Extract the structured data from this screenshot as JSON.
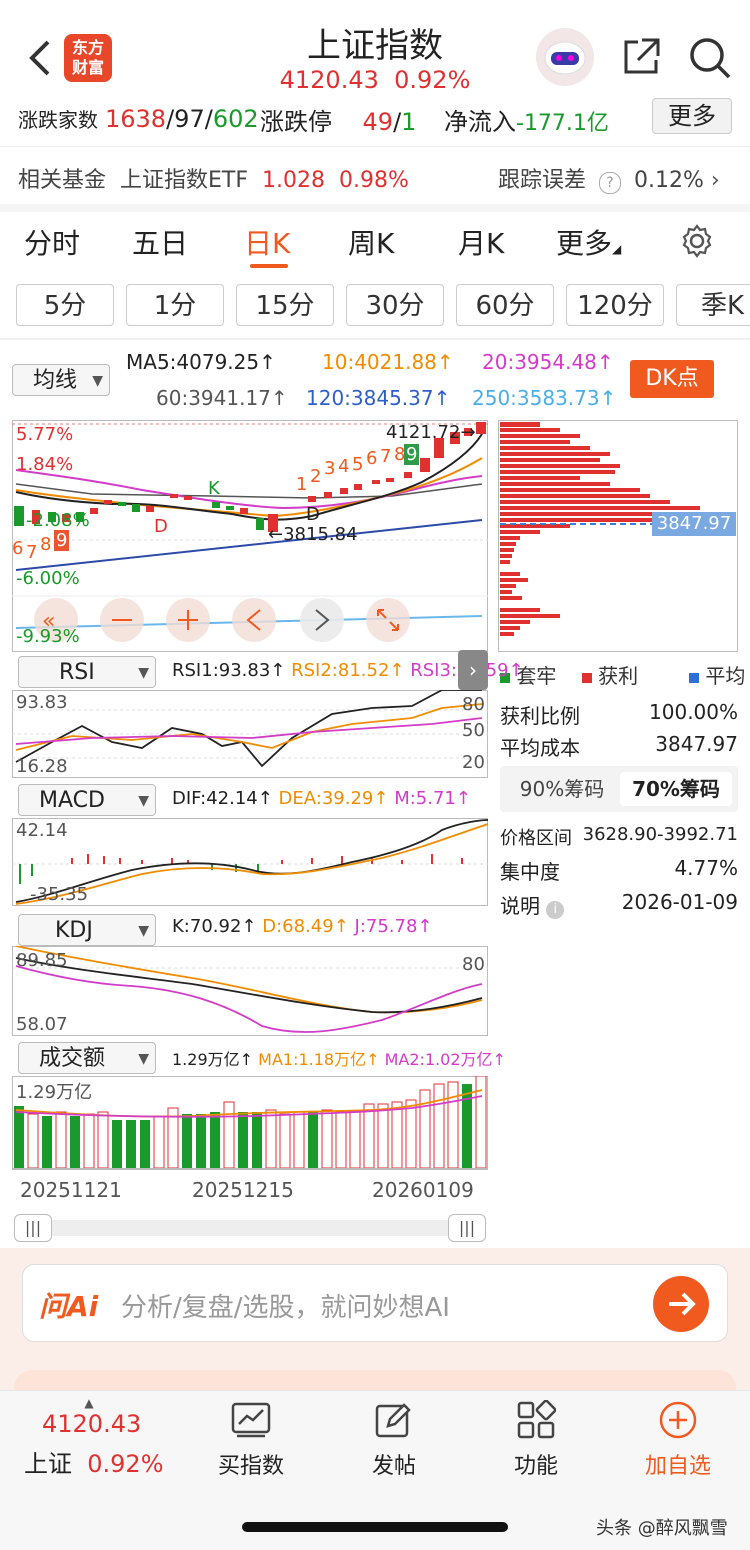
{
  "header": {
    "title": "上证指数",
    "price": "4120.43",
    "change_pct": "0.92%",
    "logo_text_1": "东方",
    "logo_text_2": "财富"
  },
  "stats": {
    "label_rise_fall": "涨跌家数",
    "rise": "1638",
    "flat": "97",
    "fall": "602",
    "label_limit": "涨跌停",
    "limit_up": "49",
    "limit_down": "1",
    "label_netflow": "净流入",
    "netflow": "-177.1亿",
    "more_button": "更多"
  },
  "fund": {
    "label": "相关基金",
    "name": "上证指数ETF",
    "price": "1.028",
    "change": "0.98%",
    "tracking_label": "跟踪误差",
    "tracking_value": "0.12%"
  },
  "tabs": [
    "分时",
    "五日",
    "日K",
    "周K",
    "月K",
    "更多"
  ],
  "active_tab": "日K",
  "intervals": [
    "5分",
    "1分",
    "15分",
    "30分",
    "60分",
    "120分",
    "季K"
  ],
  "ma": {
    "selector": "均线",
    "ma5": "MA5:4079.25",
    "ma10": "10:4021.88",
    "ma20": "20:3954.48",
    "ma60": "60:3941.17",
    "ma120": "120:3845.37",
    "ma250": "250:3583.73",
    "dk_button": "DK点"
  },
  "kchart": {
    "pct_top": "5.77%",
    "pct_2": "1.84%",
    "pct_3": "-2.08%",
    "pct_4": "-6.00%",
    "pct_5": "-9.93%",
    "high_label": "4121.72",
    "low_label": "3815.84",
    "k_mark": "K",
    "d_mark_1": "D",
    "d_mark_2": "D",
    "seq_right": [
      "1",
      "2",
      "3",
      "4",
      "5",
      "6",
      "7",
      "8",
      "9"
    ],
    "seq_left": [
      "6",
      "7",
      "8",
      "9"
    ],
    "avg_cost_tag": "3847.97"
  },
  "chip_legend": {
    "trapped": "套牢",
    "profit": "获利",
    "average": "平均"
  },
  "chip_stats": {
    "profit_ratio_label": "获利比例",
    "profit_ratio": "100.00%",
    "avg_cost_label": "平均成本",
    "avg_cost": "3847.97",
    "tab_90": "90%筹码",
    "tab_70": "70%筹码",
    "range_label": "价格区间",
    "range": "3628.90-3992.71",
    "concentration_label": "集中度",
    "concentration": "4.77%",
    "note_label": "说明",
    "date": "2026-01-09"
  },
  "rsi": {
    "selector": "RSI",
    "rsi1": "RSI1:93.83",
    "rsi2": "RSI2:81.52",
    "rsi3": "RSI3:68.59",
    "top": "93.83",
    "bottom": "16.28",
    "l80": "80",
    "l50": "50",
    "l20": "20"
  },
  "macd": {
    "selector": "MACD",
    "dif": "DIF:42.14",
    "dea": "DEA:39.29",
    "m": "M:5.71",
    "top": "42.14",
    "bottom": "-35.35"
  },
  "kdj": {
    "selector": "KDJ",
    "k": "K:70.92",
    "d": "D:68.49",
    "j": "J:75.78",
    "top": "89.85",
    "bottom": "58.07",
    "l80": "80"
  },
  "volume": {
    "selector": "成交额",
    "vol": "1.29万亿",
    "ma1": "MA1:1.18万亿",
    "ma2": "MA2:1.02万亿",
    "top": "1.29万亿",
    "date1": "20251121",
    "date2": "20251215",
    "date3": "20260109"
  },
  "ai": {
    "brand": "问Ai",
    "placeholder": "分析/复盘/选股，就问妙想AI"
  },
  "bottom_nav": {
    "price": "4120.43",
    "name": "上证",
    "pct": "0.92%",
    "buy": "买指数",
    "post": "发帖",
    "func": "功能",
    "add": "加自选"
  },
  "watermark": "头条 @醉风飘雪",
  "colors": {
    "up": "#e03030",
    "down": "#1a9a2a",
    "accent": "#f05a1e"
  }
}
